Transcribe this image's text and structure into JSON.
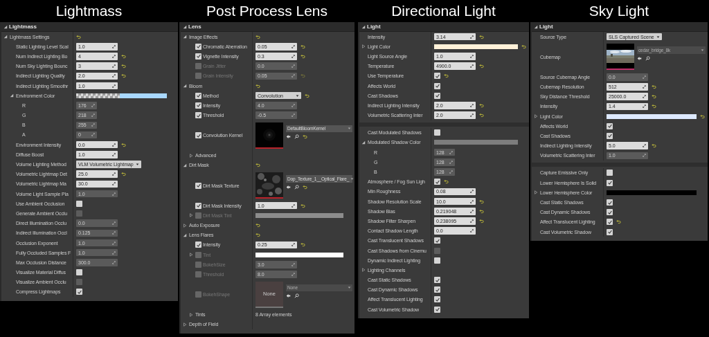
{
  "panels": [
    {
      "title": "Lightmass",
      "category": "Lightmass",
      "sections": [
        {
          "rows": [
            {
              "kind": "group",
              "label": "Lightmass Settings",
              "expanded": true,
              "reset": true,
              "children": [
                {
                  "kind": "number",
                  "label": "Static Lighting Level Scal",
                  "value": "1.0"
                },
                {
                  "kind": "number",
                  "label": "Num Indirect Lighting Bo",
                  "value": "4",
                  "reset": true
                },
                {
                  "kind": "number",
                  "label": "Num Sky Lighting Bounc",
                  "value": "3",
                  "reset": true
                },
                {
                  "kind": "number",
                  "label": "Indirect Lighting Quality",
                  "value": "2.0",
                  "reset": true
                },
                {
                  "kind": "number",
                  "label": "Indirect Lighting Smoothr",
                  "value": "1.0"
                },
                {
                  "kind": "color",
                  "label": "Environment Color",
                  "expanded": true,
                  "color": "#a9d8ff",
                  "alpha_checker": true,
                  "children": [
                    {
                      "kind": "channel",
                      "label": "R",
                      "value": "176",
                      "disabled": true
                    },
                    {
                      "kind": "channel",
                      "label": "G",
                      "value": "218",
                      "disabled": true
                    },
                    {
                      "kind": "channel",
                      "label": "B",
                      "value": "255",
                      "disabled": true
                    },
                    {
                      "kind": "channel",
                      "label": "A",
                      "value": "0",
                      "disabled": true
                    }
                  ]
                },
                {
                  "kind": "number",
                  "label": "Environment Intensity",
                  "value": "0.0",
                  "reset": true
                },
                {
                  "kind": "number",
                  "label": "Diffuse Boost",
                  "value": "1.0"
                },
                {
                  "kind": "dropdown",
                  "label": "Volume Lighting Method",
                  "value": "VLM Volumetric Lightmap"
                },
                {
                  "kind": "number",
                  "label": "Volumetric Lightmap Det",
                  "value": "25.0",
                  "reset": true
                },
                {
                  "kind": "number",
                  "label": "Volumetric Lightmap Ma",
                  "value": "30.0"
                },
                {
                  "kind": "number",
                  "label": "Volume Light Sample Pla",
                  "value": "1.0",
                  "disabled": true
                },
                {
                  "kind": "checkbox",
                  "label": "Use Ambient Occlusion",
                  "checked": false
                },
                {
                  "kind": "checkbox",
                  "label": "Generate Ambient Occlu",
                  "checked": false,
                  "disabled": true
                },
                {
                  "kind": "number",
                  "label": "Direct Illumination Occlu",
                  "value": "0.0",
                  "disabled": true
                },
                {
                  "kind": "number",
                  "label": "Indirect Illumination Occl",
                  "value": "0.125",
                  "disabled": true
                },
                {
                  "kind": "number",
                  "label": "Occlusion Exponent",
                  "value": "1.0",
                  "disabled": true
                },
                {
                  "kind": "number",
                  "label": "Fully Occluded Samples F",
                  "value": "1.0",
                  "disabled": true
                },
                {
                  "kind": "number",
                  "label": "Max Occlusion Distance",
                  "value": "300.0",
                  "disabled": true
                },
                {
                  "kind": "checkbox",
                  "label": "Visualize Material Diffus",
                  "checked": false
                },
                {
                  "kind": "checkbox",
                  "label": "Visualize Ambient Occlu",
                  "checked": false,
                  "disabled": true
                },
                {
                  "kind": "checkbox",
                  "label": "Compress Lightmaps",
                  "checked": true
                }
              ]
            }
          ]
        }
      ]
    },
    {
      "title": "Post Process Lens",
      "category": "Lens",
      "sections": [
        {
          "rows": [
            {
              "kind": "group",
              "label": "Image Effects",
              "expanded": true,
              "reset": true,
              "children": [
                {
                  "kind": "number",
                  "label": "Chromatic Aberration",
                  "value": "0.05",
                  "override": true,
                  "reset": true
                },
                {
                  "kind": "number",
                  "label": "Vignette Intensity",
                  "value": "0.3",
                  "override": true,
                  "reset": true
                },
                {
                  "kind": "number",
                  "label": "Grain Jitter",
                  "value": "0.0",
                  "override": false,
                  "disabled": true
                },
                {
                  "kind": "number",
                  "label": "Grain Intensity",
                  "value": "0.05",
                  "override": false,
                  "disabled": true,
                  "reset": true
                }
              ]
            },
            {
              "kind": "group",
              "label": "Bloom",
              "expanded": true,
              "reset": true,
              "children": [
                {
                  "kind": "dropdown",
                  "label": "Method",
                  "value": "Convolution",
                  "override": true,
                  "reset": true
                },
                {
                  "kind": "number",
                  "label": "Intensity",
                  "value": "4.0",
                  "override": true,
                  "disabled": true
                },
                {
                  "kind": "number",
                  "label": "Threshold",
                  "value": "-0.5",
                  "override": true,
                  "disabled": true
                },
                {
                  "kind": "asset",
                  "label": "Convolution Kernel",
                  "override": true,
                  "thumbnail": {
                    "kind": "kernel"
                  },
                  "asset": "DefaultBloomKernel",
                  "reset": true
                },
                {
                  "kind": "group",
                  "label": "Advanced",
                  "expanded": false
                }
              ]
            },
            {
              "kind": "group",
              "label": "Dirt Mask",
              "expanded": true,
              "reset": true,
              "children": [
                {
                  "kind": "asset",
                  "label": "Dirt Mask Texture",
                  "override": true,
                  "thumbnail": {
                    "kind": "texture"
                  },
                  "asset": "Dop_Texture_1__Optical_Flare_",
                  "reset": true
                },
                {
                  "kind": "number",
                  "label": "Dirt Mask Intensity",
                  "value": "1.0",
                  "override": true,
                  "reset": true
                },
                {
                  "kind": "color",
                  "label": "Dirt Mask Tint",
                  "expanded": false,
                  "override": false,
                  "color": "#8c8c8c"
                }
              ]
            },
            {
              "kind": "group",
              "label": "Auto Exposure",
              "expanded": false,
              "reset": true
            },
            {
              "kind": "group",
              "label": "Lens Flares",
              "expanded": true,
              "reset": true,
              "children": [
                {
                  "kind": "number",
                  "label": "Intensity",
                  "value": "0.25",
                  "override": true,
                  "reset": true
                },
                {
                  "kind": "color",
                  "label": "Tint",
                  "expanded": false,
                  "override": false,
                  "color": "#ffffff"
                },
                {
                  "kind": "number",
                  "label": "BokehSize",
                  "value": "3.0",
                  "override": false,
                  "disabled": true
                },
                {
                  "kind": "number",
                  "label": "Threshold",
                  "value": "8.0",
                  "override": false,
                  "disabled": true
                },
                {
                  "kind": "asset",
                  "label": "BokehShape",
                  "override": false,
                  "thumbnail": {
                    "kind": "empty",
                    "label": "None"
                  },
                  "asset": "None",
                  "disabled": true
                },
                {
                  "kind": "array",
                  "label": "Tints",
                  "expanded": false,
                  "value": "8 Array elements"
                }
              ]
            },
            {
              "kind": "group",
              "label": "Depth of Field",
              "expanded": false
            }
          ]
        }
      ]
    },
    {
      "title": "Directional Light",
      "category": "Light",
      "sections": [
        {
          "rows": [
            {
              "kind": "number",
              "label": "Intensity",
              "value": "3.14",
              "reset": true
            },
            {
              "kind": "color",
              "label": "Light Color",
              "expanded": false,
              "color": "#fff1d8",
              "reset": true
            },
            {
              "kind": "number",
              "label": "Light Source Angle",
              "value": "1.0"
            },
            {
              "kind": "number",
              "label": "Temperature",
              "value": "4900.0",
              "reset": true
            },
            {
              "kind": "checkbox",
              "label": "Use Temperature",
              "checked": true,
              "reset": true
            },
            {
              "kind": "checkbox",
              "label": "Affects World",
              "checked": true
            },
            {
              "kind": "checkbox",
              "label": "Cast Shadows",
              "checked": true
            },
            {
              "kind": "number",
              "label": "Indirect Lighting Intensity",
              "value": "2.0",
              "reset": true
            },
            {
              "kind": "number",
              "label": "Volumetric Scattering Inter",
              "value": "2.0",
              "reset": true
            }
          ]
        },
        {
          "rows": [
            {
              "kind": "checkbox",
              "label": "Cast Modulated Shadows",
              "checked": false
            },
            {
              "kind": "color",
              "label": "Modulated Shadow Color",
              "expanded": true,
              "color": "#7d7d7d",
              "children": [
                {
                  "kind": "channel",
                  "label": "R",
                  "value": "128",
                  "disabled": true
                },
                {
                  "kind": "channel",
                  "label": "G",
                  "value": "128",
                  "disabled": true
                },
                {
                  "kind": "channel",
                  "label": "B",
                  "value": "128",
                  "disabled": true
                }
              ]
            },
            {
              "kind": "checkbox",
              "label": "Atmosphere / Fog Sun Ligh",
              "checked": true,
              "reset": true
            },
            {
              "kind": "number",
              "label": "Min Roughness",
              "value": "0.08"
            },
            {
              "kind": "number",
              "label": "Shadow Resolution Scale",
              "value": "10.0",
              "reset": true
            },
            {
              "kind": "number",
              "label": "Shadow Bias",
              "value": "0.219048",
              "reset": true
            },
            {
              "kind": "number",
              "label": "Shadow Filter Sharpen",
              "value": "0.238095",
              "reset": true
            },
            {
              "kind": "number",
              "label": "Contact Shadow Length",
              "value": "0.0"
            },
            {
              "kind": "checkbox",
              "label": "Cast Translucent Shadows",
              "checked": true
            },
            {
              "kind": "checkbox",
              "label": "Cast Shadows from Cinemu",
              "checked": false,
              "disabled": true
            },
            {
              "kind": "checkbox",
              "label": "Dynamic Indirect Lighting",
              "checked": false
            },
            {
              "kind": "group",
              "label": "Lighting Channels",
              "expanded": false
            },
            {
              "kind": "checkbox",
              "label": "Cast Static Shadows",
              "checked": true
            },
            {
              "kind": "checkbox",
              "label": "Cast Dynamic Shadows",
              "checked": true
            },
            {
              "kind": "checkbox",
              "label": "Affect Translucent Lighting",
              "checked": true
            },
            {
              "kind": "checkbox",
              "label": "Cast Volumetric Shadow",
              "checked": true
            }
          ]
        }
      ]
    },
    {
      "title": "Sky Light",
      "category": "Light",
      "sections": [
        {
          "rows": [
            {
              "kind": "dropdown",
              "label": "Source Type",
              "value": "SLS Captured Scene"
            },
            {
              "kind": "asset",
              "label": "Cubemap",
              "thumbnail": {
                "kind": "cubemap"
              },
              "asset": "cedar_bridge_8k",
              "disabled": true
            },
            {
              "kind": "number",
              "label": "Source Cubemap Angle",
              "value": "0.0",
              "disabled": true
            },
            {
              "kind": "number",
              "label": "Cubemap Resolution",
              "value": "512",
              "reset": true
            },
            {
              "kind": "number",
              "label": "Sky Distance Threshold",
              "value": "25000.0",
              "reset": true
            },
            {
              "kind": "number",
              "label": "Intensity",
              "value": "1.4",
              "reset": true
            },
            {
              "kind": "color",
              "label": "Light Color",
              "expanded": false,
              "color": "#dde9ff",
              "reset": true
            },
            {
              "kind": "checkbox",
              "label": "Affects World",
              "checked": true
            },
            {
              "kind": "checkbox",
              "label": "Cast Shadows",
              "checked": true
            },
            {
              "kind": "number",
              "label": "Indirect Lighting Intensity",
              "value": "5.0",
              "reset": true
            },
            {
              "kind": "number",
              "label": "Volumetric Scattering Inter",
              "value": "1.0",
              "disabled": true
            }
          ]
        },
        {
          "rows": [
            {
              "kind": "checkbox",
              "label": "Capture Emissive Only",
              "checked": false
            },
            {
              "kind": "checkbox",
              "label": "Lower Hemisphere Is Solid",
              "checked": true
            },
            {
              "kind": "color",
              "label": "Lower Hemisphere Color",
              "expanded": false,
              "color": "#000000"
            },
            {
              "kind": "checkbox",
              "label": "Cast Static Shadows",
              "checked": true
            },
            {
              "kind": "checkbox",
              "label": "Cast Dynamic Shadows",
              "checked": true
            },
            {
              "kind": "checkbox",
              "label": "Affect Translucent Lighting",
              "checked": true,
              "reset": true
            },
            {
              "kind": "checkbox",
              "label": "Cast Volumetric Shadow",
              "checked": true
            }
          ]
        }
      ]
    }
  ]
}
